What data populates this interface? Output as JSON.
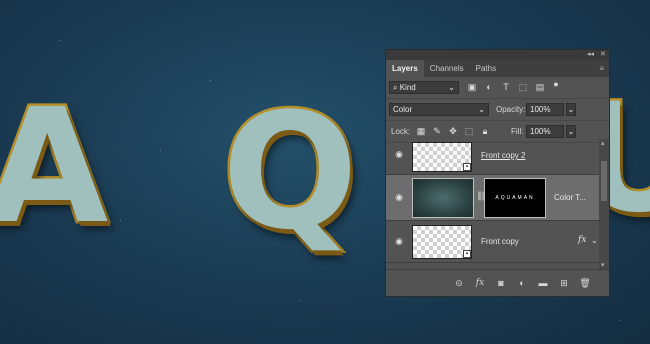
{
  "artwork": {
    "letters": [
      "A",
      "Q",
      "U"
    ]
  },
  "panel": {
    "tabs": [
      "Layers",
      "Channels",
      "Paths"
    ],
    "filter_kind": "Kind",
    "blend_mode": "Color",
    "opacity_label": "Opacity:",
    "opacity_value": "100%",
    "lock_label": "Lock:",
    "fill_label": "Fill:",
    "fill_value": "100%",
    "layers": [
      {
        "name": "Front copy 2",
        "fx": ""
      },
      {
        "name": "Color T...",
        "mask_text": "AQUAMAN",
        "fx": ""
      },
      {
        "name": "Front copy",
        "fx": "fx"
      }
    ]
  },
  "icons": {
    "search": "search-icon",
    "eye": "eye-icon",
    "link": "link-icon"
  },
  "colors": {
    "panel_bg": "#535353",
    "panel_dark": "#3a3a3a",
    "selected_layer": "#6d6d6d",
    "canvas_bg": "#1b3d55",
    "letter_face": "#9fc0bc",
    "letter_gold": "#b58f2a"
  }
}
